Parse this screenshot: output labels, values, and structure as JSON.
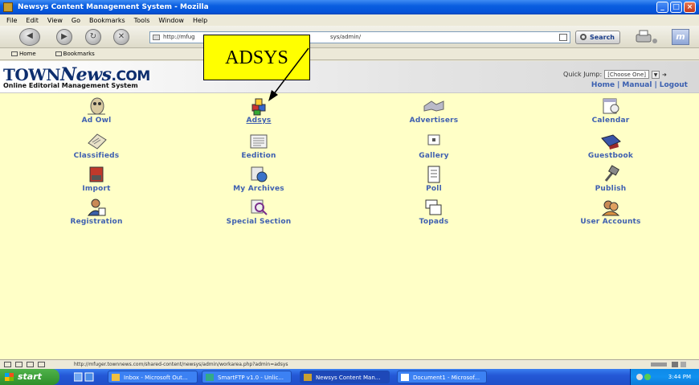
{
  "window": {
    "title": "Newsys Content Management System - Mozilla",
    "controls": [
      "_",
      "□",
      "×"
    ]
  },
  "menu": [
    "File",
    "Edit",
    "View",
    "Go",
    "Bookmarks",
    "Tools",
    "Window",
    "Help"
  ],
  "toolbar": {
    "url_prefix": "http://mfug",
    "url_suffix": "sys/admin/",
    "search_label": "Search"
  },
  "bookmarks": [
    "Home",
    "Bookmarks"
  ],
  "site": {
    "logo_prefix": "TOWN",
    "logo_big": "News",
    "logo_suffix": ".COM",
    "tagline": "Online Editorial Management System",
    "quick_jump_label": "Quick Jump:",
    "quick_jump_value": "[Choose One]",
    "links": [
      "Home",
      "Manual",
      "Logout"
    ]
  },
  "modules": [
    {
      "label": "Ad Owl",
      "icon": "owl-icon"
    },
    {
      "label": "Adsys",
      "icon": "blocks-icon"
    },
    {
      "label": "Advertisers",
      "icon": "handshake-icon"
    },
    {
      "label": "Calendar",
      "icon": "calendar-icon"
    },
    {
      "label": "Classifieds",
      "icon": "newspaper-icon"
    },
    {
      "label": "Eedition",
      "icon": "eedition-icon"
    },
    {
      "label": "Gallery",
      "icon": "gallery-icon"
    },
    {
      "label": "Guestbook",
      "icon": "guestbook-icon"
    },
    {
      "label": "Import",
      "icon": "import-icon"
    },
    {
      "label": "My Archives",
      "icon": "archives-icon"
    },
    {
      "label": "Poll",
      "icon": "poll-icon"
    },
    {
      "label": "Publish",
      "icon": "publish-icon"
    },
    {
      "label": "Registration",
      "icon": "registration-icon"
    },
    {
      "label": "Special Section",
      "icon": "special-section-icon"
    },
    {
      "label": "Topads",
      "icon": "topads-icon"
    },
    {
      "label": "User Accounts",
      "icon": "user-accounts-icon"
    }
  ],
  "callout": {
    "text": "ADSYS"
  },
  "status": {
    "url": "http://mfuger.townnews.com/shared-content/newsys/admin/workarea.php?admin=adsys"
  },
  "taskbar": {
    "start": "start",
    "tasks": [
      "Inbox - Microsoft Out...",
      "SmartFTP v1.0 - Unlic...",
      "Newsys Content Man...",
      "Document1 - Microsof..."
    ],
    "clock": "3:44 PM"
  },
  "colors": {
    "content_bg": "#ffffc7",
    "link_blue": "#3e5fb0",
    "callout_yellow": "#ffff00",
    "titlebar_blue": "#0553d8"
  }
}
